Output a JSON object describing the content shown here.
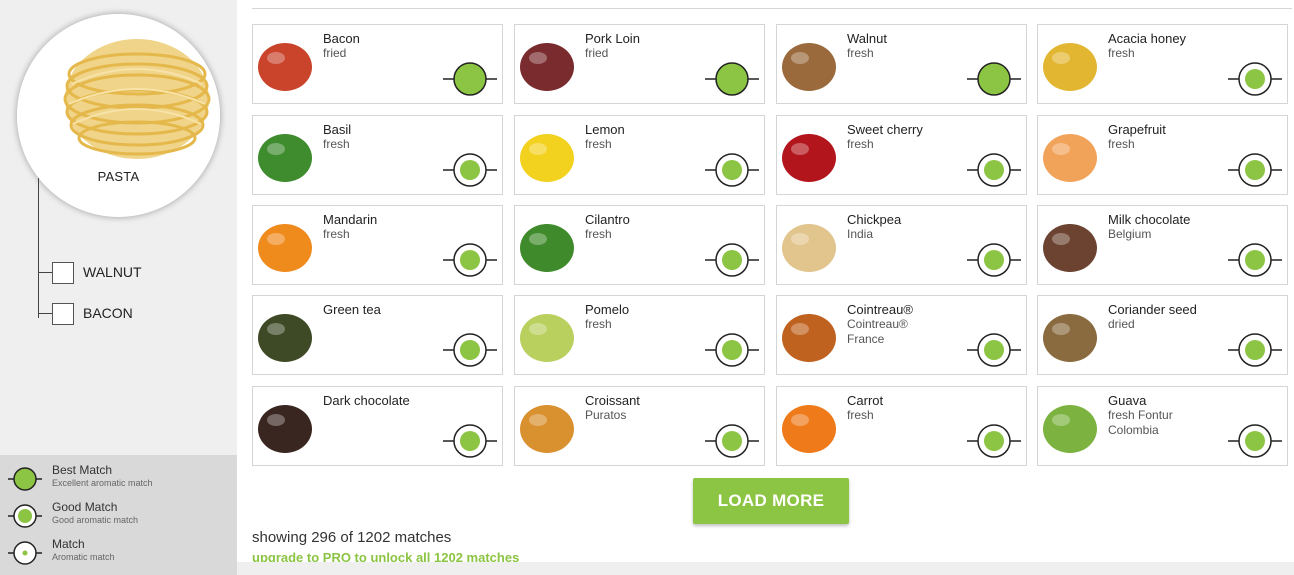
{
  "main_ingredient": {
    "name": "PASTA",
    "image_icon": "pasta-nest-icon"
  },
  "pairings": [
    {
      "label": "WALNUT"
    },
    {
      "label": "BACON"
    }
  ],
  "legend": [
    {
      "title": "Best Match",
      "desc": "Excellent aromatic match",
      "level": "best"
    },
    {
      "title": "Good Match",
      "desc": "Good aromatic match",
      "level": "good"
    },
    {
      "title": "Match",
      "desc": "Aromatic match",
      "level": "match"
    }
  ],
  "colors": {
    "accent": "#8cc443",
    "sidebar_bg": "#efefef",
    "legend_bg": "#d9d9d9"
  },
  "cards": [
    {
      "name": "Bacon",
      "lines": [
        "fried"
      ],
      "match": "best",
      "icon": "bacon-icon",
      "thumb": "#c9442b"
    },
    {
      "name": "Pork Loin",
      "lines": [
        "fried"
      ],
      "match": "best",
      "icon": "pork-loin-icon",
      "thumb": "#7a2b2e"
    },
    {
      "name": "Walnut",
      "lines": [
        "fresh"
      ],
      "match": "best",
      "icon": "walnut-icon",
      "thumb": "#9a6a3c"
    },
    {
      "name": "Acacia honey",
      "lines": [
        "fresh"
      ],
      "match": "good",
      "icon": "honey-icon",
      "thumb": "#e3b631"
    },
    {
      "name": "Basil",
      "lines": [
        "fresh"
      ],
      "match": "good",
      "icon": "basil-icon",
      "thumb": "#3e8c2e"
    },
    {
      "name": "Lemon",
      "lines": [
        "fresh"
      ],
      "match": "good",
      "icon": "lemon-icon",
      "thumb": "#f2d21e"
    },
    {
      "name": "Sweet cherry",
      "lines": [
        "fresh"
      ],
      "match": "good",
      "icon": "cherry-icon",
      "thumb": "#b3151d"
    },
    {
      "name": "Grapefruit",
      "lines": [
        "fresh"
      ],
      "match": "good",
      "icon": "grapefruit-icon",
      "thumb": "#f1a35a"
    },
    {
      "name": "Mandarin",
      "lines": [
        "fresh"
      ],
      "match": "good",
      "icon": "mandarin-icon",
      "thumb": "#ef8a1d"
    },
    {
      "name": "Cilantro",
      "lines": [
        "fresh"
      ],
      "match": "good",
      "icon": "cilantro-icon",
      "thumb": "#3f8a2a"
    },
    {
      "name": "Chickpea",
      "lines": [
        "India"
      ],
      "match": "good",
      "icon": "chickpea-icon",
      "thumb": "#e2c48d"
    },
    {
      "name": "Milk chocolate",
      "lines": [
        "Belgium"
      ],
      "match": "good",
      "icon": "chocolate-icon",
      "thumb": "#6b4330"
    },
    {
      "name": "Green tea",
      "lines": [],
      "match": "good",
      "icon": "green-tea-icon",
      "thumb": "#3e4a26"
    },
    {
      "name": "Pomelo",
      "lines": [
        "fresh"
      ],
      "match": "good",
      "icon": "pomelo-icon",
      "thumb": "#b9cf5e"
    },
    {
      "name": "Cointreau®",
      "lines": [
        "Cointreau®",
        "France"
      ],
      "match": "good",
      "icon": "liqueur-bottle-icon",
      "thumb": "#c0621f"
    },
    {
      "name": "Coriander seed",
      "lines": [
        "dried"
      ],
      "match": "good",
      "icon": "coriander-seed-icon",
      "thumb": "#8a6a3f"
    },
    {
      "name": "Dark chocolate",
      "lines": [],
      "match": "good",
      "icon": "dark-chocolate-icon",
      "thumb": "#3a2620"
    },
    {
      "name": "Croissant",
      "lines": [
        "Puratos"
      ],
      "match": "good",
      "icon": "croissant-icon",
      "thumb": "#d9902f"
    },
    {
      "name": "Carrot",
      "lines": [
        "fresh"
      ],
      "match": "good",
      "icon": "carrot-icon",
      "thumb": "#ef7a1a"
    },
    {
      "name": "Guava",
      "lines": [
        "fresh  Fontur",
        "Colombia"
      ],
      "match": "good",
      "icon": "guava-icon",
      "thumb": "#7cb340"
    }
  ],
  "load_more_label": "LOAD MORE",
  "showing_text": "showing 296 of 1202 matches",
  "upgrade_text": "upgrade to PRO to unlock all 1202 matches"
}
